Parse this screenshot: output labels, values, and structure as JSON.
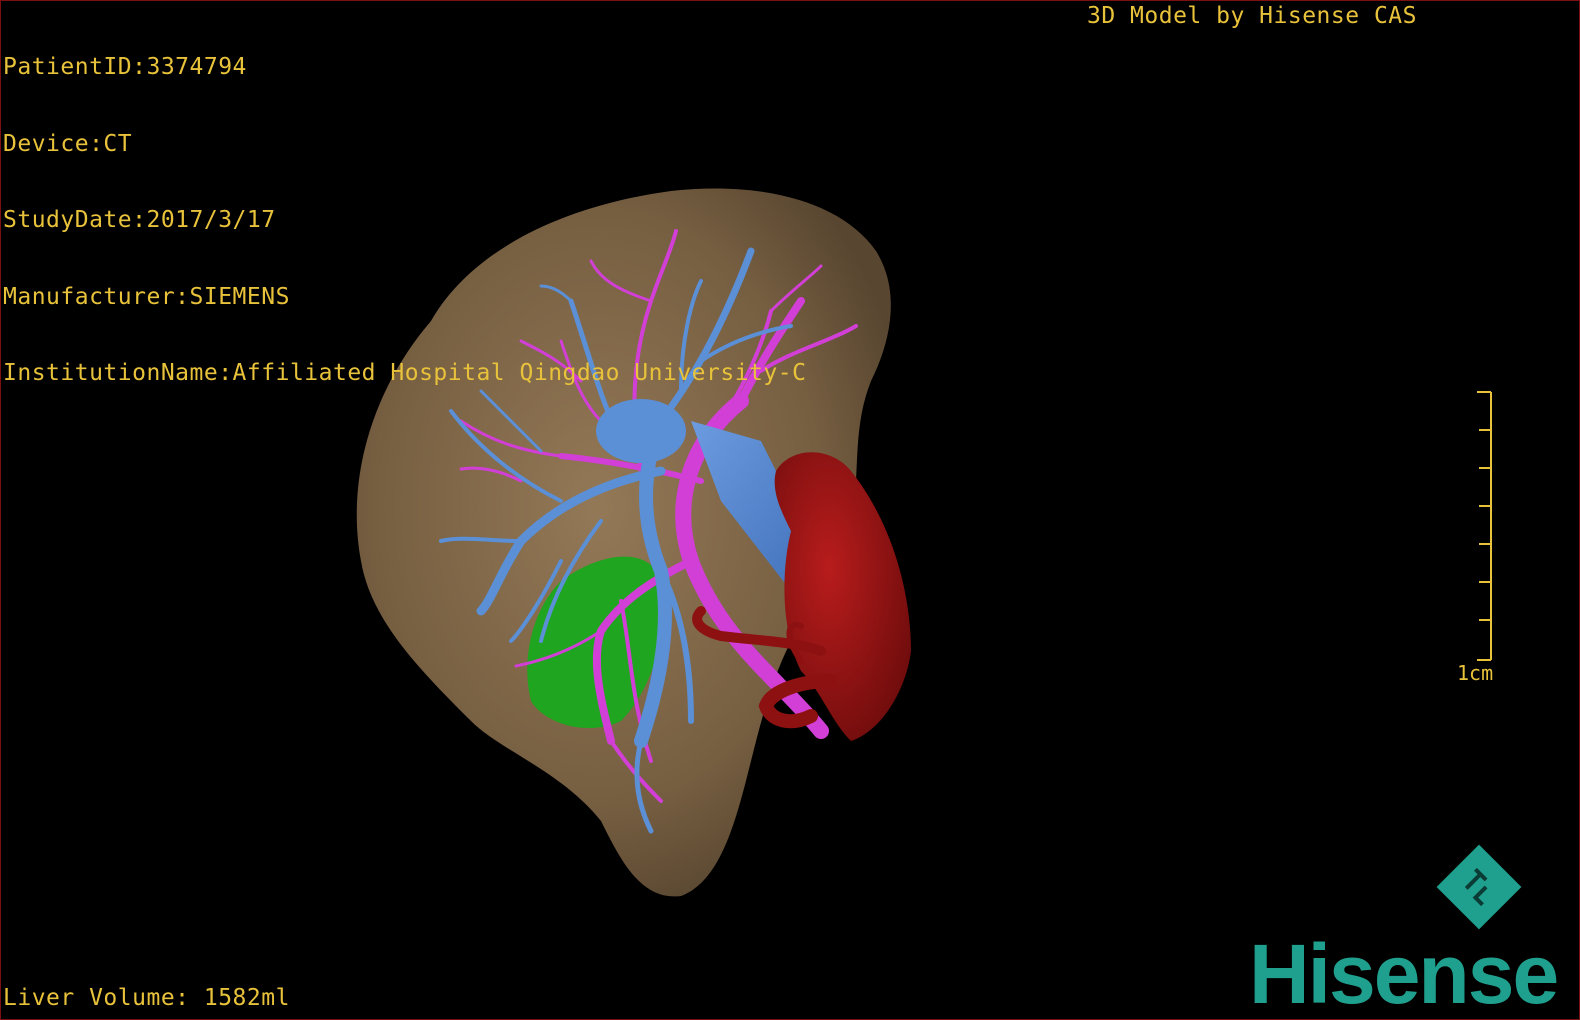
{
  "patient": {
    "id_label": "PatientID:3374794",
    "device_label": "Device:CT",
    "study_date_label": "StudyDate:2017/3/17",
    "manufacturer_label": "Manufacturer:SIEMENS",
    "institution_label": "InstitutionName:Affiliated Hospital Qingdao University-C"
  },
  "credit": "3D Model by Hisense CAS",
  "liver_volume_label": "Liver Volume: 1582ml",
  "scale": {
    "label": "1cm",
    "ticks": 8
  },
  "brand": {
    "name": "Hisense",
    "color": "#1fa08e"
  },
  "colors": {
    "overlay_text": "#e8c23a",
    "liver": "#8a6f4e",
    "hepatic_vein": "#5b8fd6",
    "portal_vein": "#d13fd6",
    "artery_aorta": "#9c1414",
    "gallbladder": "#1fa51f"
  }
}
